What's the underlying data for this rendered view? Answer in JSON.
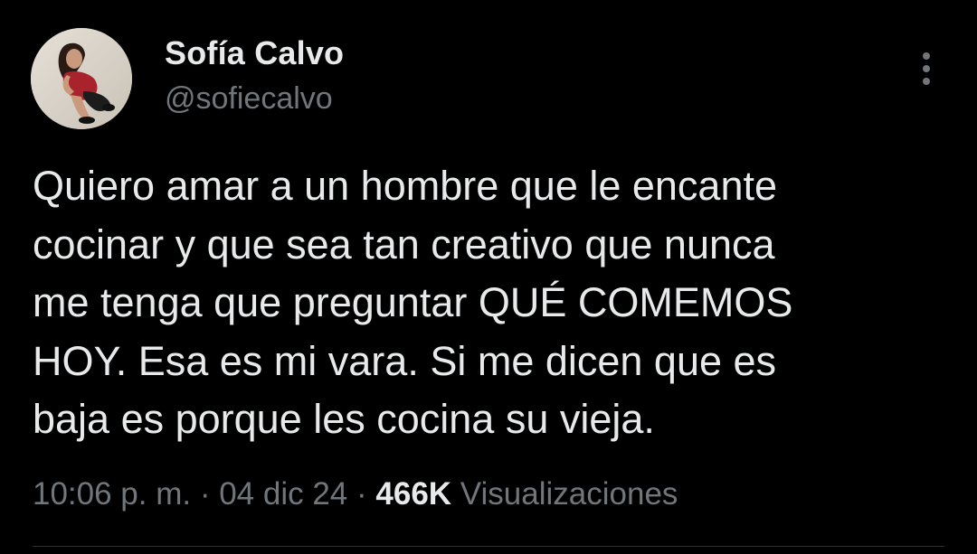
{
  "author": {
    "display_name": "Sofía Calvo",
    "handle": "@sofiecalvo",
    "avatar_icon": "profile-photo"
  },
  "tweet": {
    "lines": [
      "Quiero amar a un hombre que le encante",
      "cocinar y que sea tan creativo que nunca",
      "me tenga que preguntar QUÉ COMEMOS",
      "HOY. Esa es mi vara. Si me dicen que es",
      "baja es porque les cocina su vieja."
    ]
  },
  "meta": {
    "time": "10:06 p. m.",
    "separator": " · ",
    "date": "04 dic 24",
    "views_count": "466K",
    "views_label": "Visualizaciones"
  },
  "colors": {
    "background": "#000000",
    "primary_text": "#e7e9ea",
    "secondary_text": "#71767b",
    "divider": "#2f3336"
  }
}
